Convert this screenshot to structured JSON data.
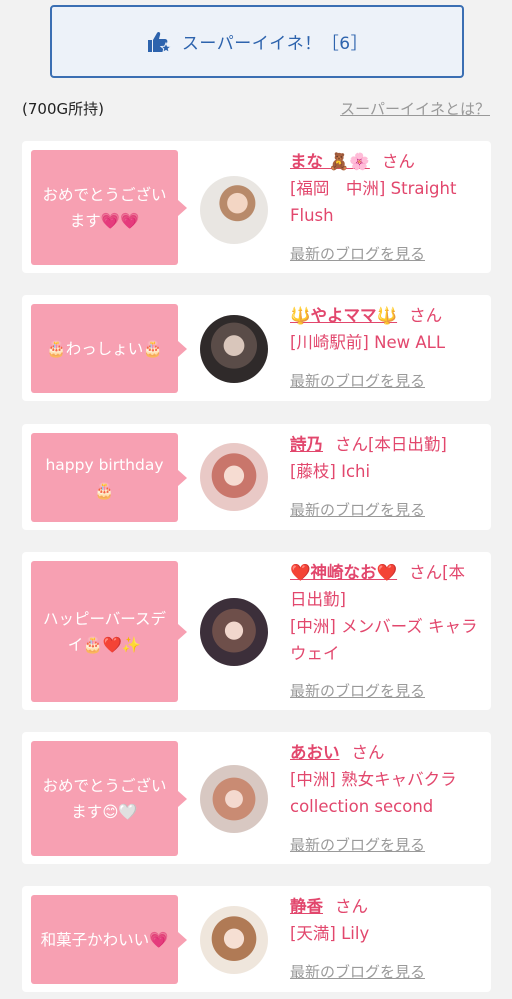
{
  "super_button": {
    "label": "スーパーイイネ！［6］",
    "icon": "thumbs-up-star-icon"
  },
  "balance": "(700G所持)",
  "what_link": "スーパーイイネとは？",
  "blog_link": "最新のブログを見る",
  "san": "さん",
  "cards": [
    {
      "message": "おめでとうございます💗💗",
      "name": "まな 🧸🌸",
      "suffix": "",
      "shop": "[福岡　中洲] Straight Flush"
    },
    {
      "message": "🎂わっしょい🎂",
      "name": "🔱やよママ🔱",
      "suffix": "",
      "shop": "[川崎駅前] New ALL"
    },
    {
      "message": "happy birthday 🎂",
      "name": "詩乃",
      "suffix": "[本日出勤]",
      "shop": "[藤枝] Ichi"
    },
    {
      "message": "ハッピーバースデイ🎂❤️✨",
      "name": "❤️神崎なお❤️",
      "suffix": "[本日出勤]",
      "shop": "[中洲] メンバーズ キャラウェイ"
    },
    {
      "message": "おめでとうございます😊🤍",
      "name": "あおい",
      "suffix": "",
      "shop": "[中洲] 熟女キャバクラ collection second"
    },
    {
      "message": "和菓子かわいい💗",
      "name": "静香",
      "suffix": "",
      "shop": "[天満] Lily"
    }
  ],
  "colors": {
    "accent_blue": "#2d63ad",
    "pink": "#f7a0b2",
    "name_pink": "#e2476d"
  }
}
